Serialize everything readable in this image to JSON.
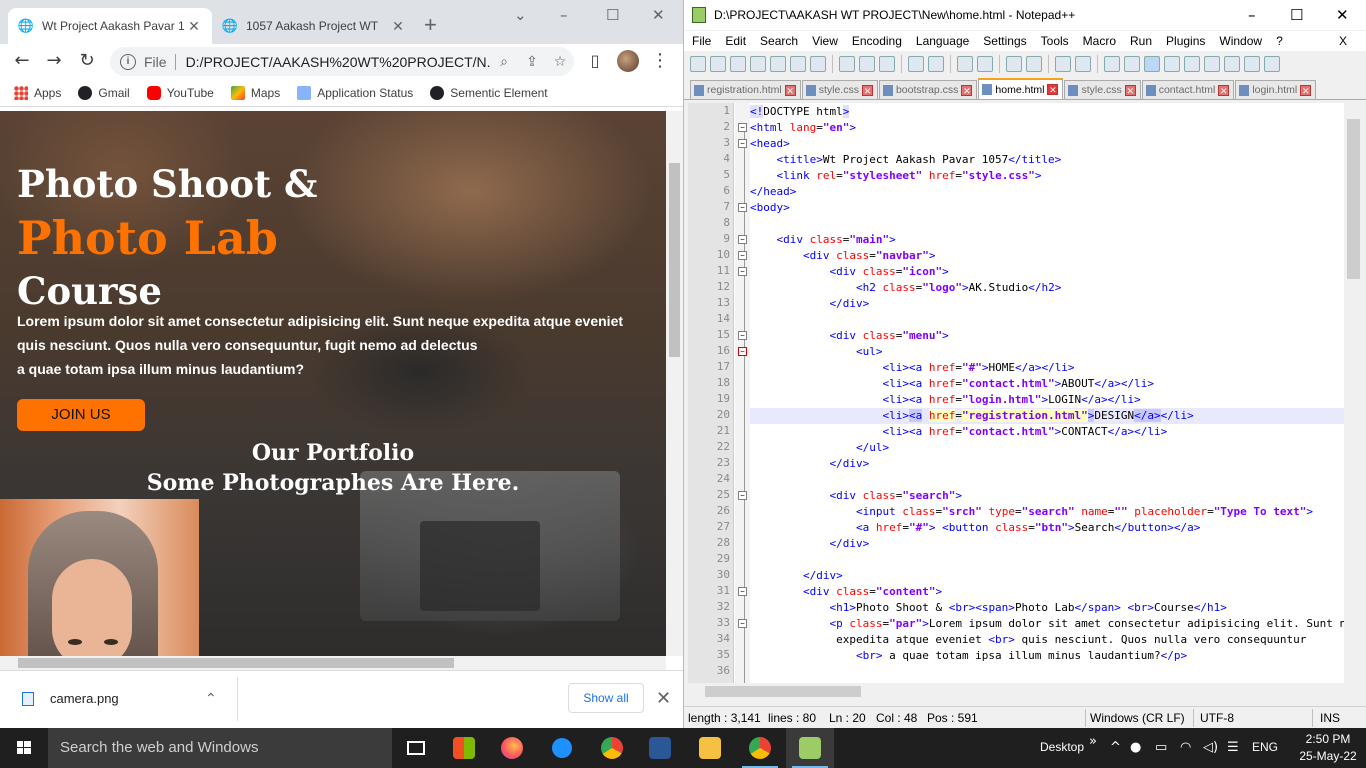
{
  "chrome": {
    "tabs": [
      {
        "title": "Wt Project Aakash Pavar 1",
        "icon": "globe-icon"
      },
      {
        "title": "1057 Aakash Project WT",
        "icon": "globe-icon"
      }
    ],
    "omnibox": {
      "scheme_label": "File",
      "url": "D:/PROJECT/AAKASH%20WT%20PROJECT/N..."
    },
    "bookmarks": [
      {
        "label": "Apps",
        "color": "#1a73e8"
      },
      {
        "label": "Gmail",
        "color": "#202124"
      },
      {
        "label": "YouTube",
        "color": "#ff0000"
      },
      {
        "label": "Maps",
        "color": "#34a853"
      },
      {
        "label": "Application Status",
        "color": "#5f6368"
      },
      {
        "label": "Sementic Element",
        "color": "#202124"
      }
    ],
    "page": {
      "title_line1": "Photo Shoot &",
      "title_line2": "Photo Lab",
      "title_line3": "Course",
      "paragraph_line1": "Lorem ipsum dolor sit amet consectetur adipisicing elit. Sunt neque expedita atque eveniet",
      "paragraph_line2": "quis nesciunt. Quos nulla vero consequuntur, fugit nemo ad delectus",
      "paragraph_line3": "a quae totam ipsa illum minus laudantium?",
      "join_button": "JOIN US",
      "portfolio_title": "Our Portfolio",
      "portfolio_subtitle": "Some Photographes Are Here.",
      "accent_color": "#ff7200"
    },
    "downloads": {
      "file_name": "camera.png",
      "show_all": "Show all"
    }
  },
  "notepad": {
    "title": "D:\\PROJECT\\AAKASH WT PROJECT\\New\\home.html - Notepad++",
    "menu": [
      "File",
      "Edit",
      "Search",
      "View",
      "Encoding",
      "Language",
      "Settings",
      "Tools",
      "Macro",
      "Run",
      "Plugins",
      "Window",
      "?"
    ],
    "menu_close": "X",
    "tabs": [
      {
        "label": "registration.html",
        "active": false
      },
      {
        "label": "style.css",
        "active": false
      },
      {
        "label": "bootstrap.css",
        "active": false
      },
      {
        "label": "home.html",
        "active": true
      },
      {
        "label": "style.css",
        "active": false
      },
      {
        "label": "contact.html",
        "active": false
      },
      {
        "label": "login.html",
        "active": false
      }
    ],
    "line_numbers": [
      "1",
      "2",
      "3",
      "4",
      "5",
      "6",
      "7",
      "8",
      "9",
      "10",
      "11",
      "12",
      "13",
      "14",
      "15",
      "16",
      "17",
      "18",
      "19",
      "20",
      "21",
      "22",
      "23",
      "24",
      "25",
      "26",
      "27",
      "28",
      "29",
      "30",
      "31",
      "32",
      "33",
      "34",
      "35",
      "36"
    ],
    "status": {
      "length": "length : 3,141",
      "lines": "lines : 80",
      "ln": "Ln : 20",
      "col": "Col : 48",
      "pos": "Pos : 591",
      "eol": "Windows (CR LF)",
      "encoding": "UTF-8",
      "mode": "INS"
    }
  },
  "taskbar": {
    "search_placeholder": "Search the web and Windows",
    "desktop_label": "Desktop",
    "language": "ENG",
    "time": "2:50 PM",
    "date": "25-May-22"
  }
}
